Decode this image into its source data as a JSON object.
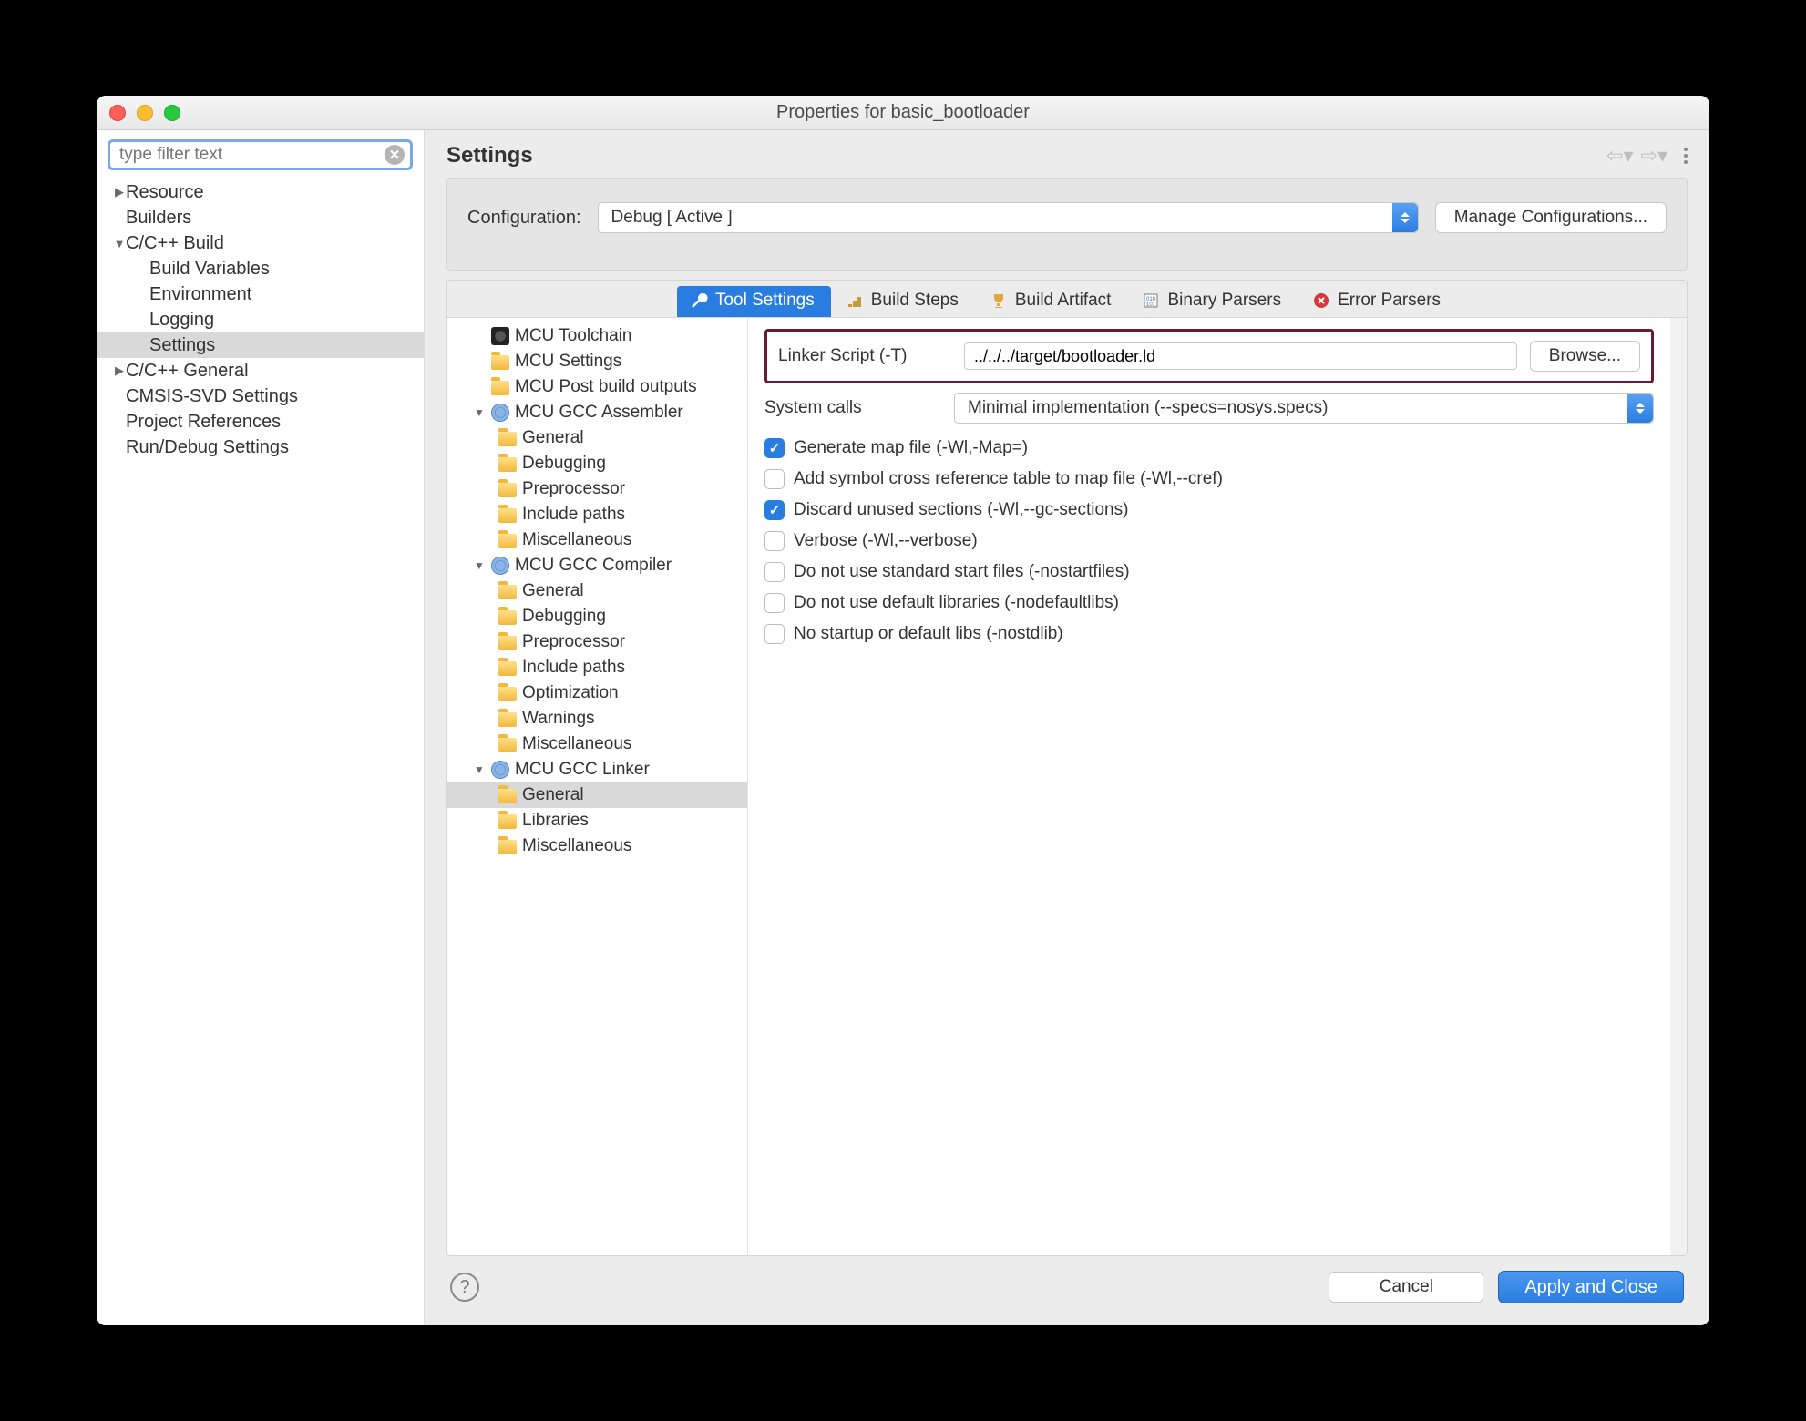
{
  "window": {
    "title": "Properties for basic_bootloader"
  },
  "sidebar": {
    "filter_placeholder": "type filter text",
    "items": [
      {
        "label": "Resource",
        "arrow": "▶",
        "indent": 0
      },
      {
        "label": "Builders",
        "arrow": "",
        "indent": 0
      },
      {
        "label": "C/C++ Build",
        "arrow": "▼",
        "indent": 0
      },
      {
        "label": "Build Variables",
        "arrow": "",
        "indent": 1
      },
      {
        "label": "Environment",
        "arrow": "",
        "indent": 1
      },
      {
        "label": "Logging",
        "arrow": "",
        "indent": 1
      },
      {
        "label": "Settings",
        "arrow": "",
        "indent": 1,
        "selected": true
      },
      {
        "label": "C/C++ General",
        "arrow": "▶",
        "indent": 0
      },
      {
        "label": "CMSIS-SVD Settings",
        "arrow": "",
        "indent": 0
      },
      {
        "label": "Project References",
        "arrow": "",
        "indent": 0
      },
      {
        "label": "Run/Debug Settings",
        "arrow": "",
        "indent": 0
      }
    ]
  },
  "header": {
    "title": "Settings"
  },
  "config": {
    "label": "Configuration:",
    "value": "Debug  [ Active ]",
    "manage": "Manage Configurations..."
  },
  "tabs": [
    {
      "label": "Tool Settings",
      "active": true,
      "icon": "wrench"
    },
    {
      "label": "Build Steps",
      "icon": "steps"
    },
    {
      "label": "Build Artifact",
      "icon": "trophy"
    },
    {
      "label": "Binary Parsers",
      "icon": "binary"
    },
    {
      "label": "Error Parsers",
      "icon": "error"
    }
  ],
  "tool_tree": [
    {
      "label": "MCU Toolchain",
      "icon": "chip",
      "indent": 1
    },
    {
      "label": "MCU Settings",
      "icon": "folder",
      "indent": 1
    },
    {
      "label": "MCU Post build outputs",
      "icon": "folder",
      "indent": 1
    },
    {
      "label": "MCU GCC Assembler",
      "icon": "gear",
      "indent": 1,
      "arrow": "▼"
    },
    {
      "label": "General",
      "icon": "folder",
      "indent": 2
    },
    {
      "label": "Debugging",
      "icon": "folder",
      "indent": 2
    },
    {
      "label": "Preprocessor",
      "icon": "folder",
      "indent": 2
    },
    {
      "label": "Include paths",
      "icon": "folder",
      "indent": 2
    },
    {
      "label": "Miscellaneous",
      "icon": "folder",
      "indent": 2
    },
    {
      "label": "MCU GCC Compiler",
      "icon": "gear",
      "indent": 1,
      "arrow": "▼"
    },
    {
      "label": "General",
      "icon": "folder",
      "indent": 2
    },
    {
      "label": "Debugging",
      "icon": "folder",
      "indent": 2
    },
    {
      "label": "Preprocessor",
      "icon": "folder",
      "indent": 2
    },
    {
      "label": "Include paths",
      "icon": "folder",
      "indent": 2
    },
    {
      "label": "Optimization",
      "icon": "folder",
      "indent": 2
    },
    {
      "label": "Warnings",
      "icon": "folder",
      "indent": 2
    },
    {
      "label": "Miscellaneous",
      "icon": "folder",
      "indent": 2
    },
    {
      "label": "MCU GCC Linker",
      "icon": "gear",
      "indent": 1,
      "arrow": "▼"
    },
    {
      "label": "General",
      "icon": "folder",
      "indent": 2,
      "selected": true
    },
    {
      "label": "Libraries",
      "icon": "folder",
      "indent": 2
    },
    {
      "label": "Miscellaneous",
      "icon": "folder",
      "indent": 2
    }
  ],
  "form": {
    "linker_script_label": "Linker Script (-T)",
    "linker_script_value": "../../../target/bootloader.ld",
    "browse": "Browse...",
    "system_calls_label": "System calls",
    "system_calls_value": "Minimal implementation (--specs=nosys.specs)",
    "checks": [
      {
        "label": "Generate map file (-Wl,-Map=)",
        "checked": true
      },
      {
        "label": "Add symbol cross reference table to map file (-Wl,--cref)",
        "checked": false
      },
      {
        "label": "Discard unused sections (-Wl,--gc-sections)",
        "checked": true
      },
      {
        "label": "Verbose (-Wl,--verbose)",
        "checked": false
      },
      {
        "label": "Do not use standard start files (-nostartfiles)",
        "checked": false
      },
      {
        "label": "Do not use default libraries (-nodefaultlibs)",
        "checked": false
      },
      {
        "label": "No startup or default libs (-nostdlib)",
        "checked": false
      }
    ]
  },
  "footer": {
    "cancel": "Cancel",
    "apply": "Apply and Close"
  }
}
